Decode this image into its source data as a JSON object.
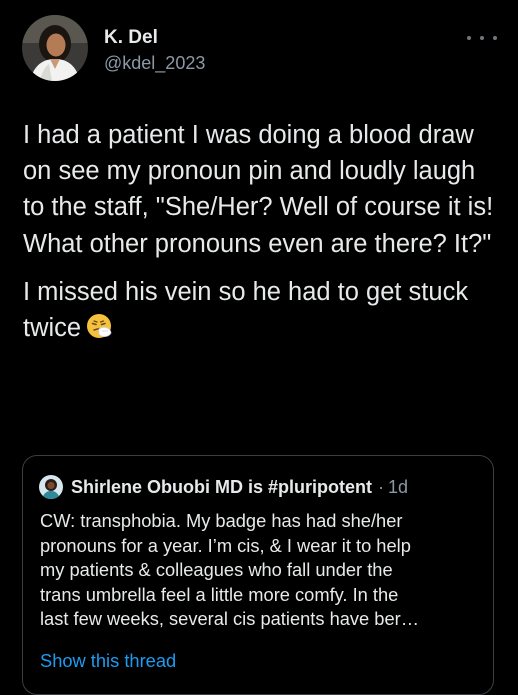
{
  "tweet": {
    "author": {
      "name": "K. Del",
      "handle": "@kdel_2023",
      "avatar_icon": "profile-photo-avatar"
    },
    "more_icon": "more-horizontal-icon",
    "body": {
      "paragraph_1": "I had a patient I was doing a blood draw on see my pronoun pin and loudly laugh to the staff, \"She/Her? Well of course it is! What other pronouns even are there? It?\"",
      "paragraph_2": "I missed his vein so he had to get stuck twice",
      "emoji_icon": "sneezing-face-emoji-icon"
    }
  },
  "quoted_tweet": {
    "author_name": "Shirlene Obuobi MD is #pluripotent",
    "separator": "·",
    "timestamp": "1d",
    "avatar_icon": "profile-photo-avatar",
    "text_lines": [
      "CW: transphobia. My badge has had she/her",
      "pronouns for a year. I’m cis, & I wear it to help",
      "my patients & colleagues who fall under the",
      "trans umbrella feel a little more comfy. In the",
      "last few weeks, several cis patients have ber…"
    ],
    "show_thread_label": "Show this thread"
  },
  "colors": {
    "background": "#000000",
    "primary_text": "#e7e9ea",
    "secondary_text": "#8b98a5",
    "link": "#1d9bf0",
    "border": "#3a3f44"
  }
}
